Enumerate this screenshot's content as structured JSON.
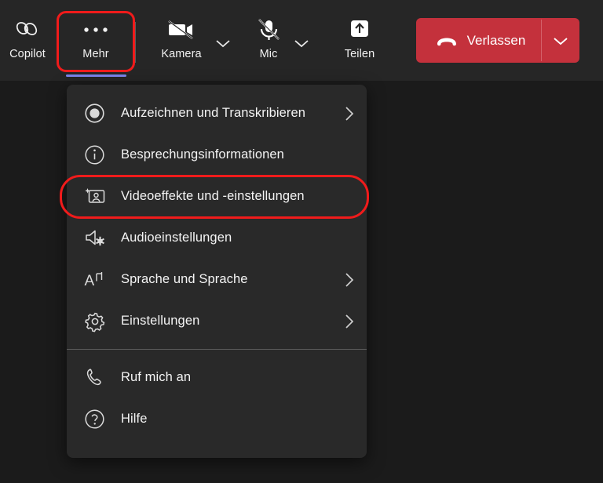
{
  "app": {
    "background_color": "#1b1b1b",
    "toolbar_color": "#262626",
    "menu_color": "#292929",
    "accent_color": "#7b83eb",
    "leave_color": "#c4313c",
    "highlight_color": "#f01b1b"
  },
  "toolbar": {
    "copilot": {
      "label": "Copilot",
      "icon": "copilot-icon"
    },
    "more": {
      "label": "Mehr",
      "icon": "ellipsis-icon",
      "active": true
    },
    "camera": {
      "label": "Kamera",
      "icon": "camera-off-icon",
      "caret": "chevron-down-icon"
    },
    "mic": {
      "label": "Mic",
      "icon": "microphone-off-icon",
      "caret": "chevron-down-icon"
    },
    "share": {
      "label": "Teilen",
      "icon": "share-screen-icon"
    },
    "leave": {
      "label": "Verlassen",
      "icon": "hangup-icon",
      "caret": "chevron-down-icon"
    }
  },
  "menu": {
    "items": [
      {
        "label": "Aufzeichnen und Transkribieren",
        "icon": "record-icon",
        "submenu": true
      },
      {
        "label": "Besprechungsinformationen",
        "icon": "info-icon",
        "submenu": false
      },
      {
        "label": "Videoeffekte und -einstellungen",
        "icon": "video-effects-icon",
        "submenu": false,
        "highlighted": true
      },
      {
        "label": "Audioeinstellungen",
        "icon": "speaker-settings-icon",
        "submenu": false
      },
      {
        "label": "Sprache und Sprache",
        "icon": "language-icon",
        "submenu": true
      },
      {
        "label": "Einstellungen",
        "icon": "gear-icon",
        "submenu": true
      }
    ],
    "items_after_separator": [
      {
        "label": "Ruf mich an",
        "icon": "phone-icon",
        "submenu": false
      },
      {
        "label": "Hilfe",
        "icon": "help-icon",
        "submenu": false
      }
    ]
  },
  "annotations": {
    "more_button_highlight": "Mehr",
    "video_effects_highlight": "Videoeffekte und -einstellungen"
  }
}
